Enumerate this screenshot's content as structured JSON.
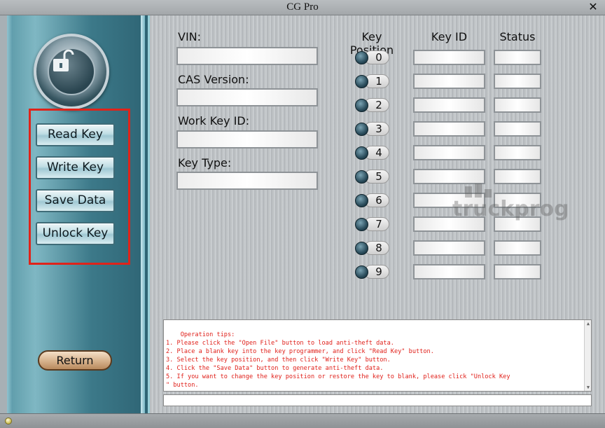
{
  "window": {
    "title": "CG Pro",
    "close_glyph": "✕"
  },
  "sidebar": {
    "buttons": [
      "Read Key",
      "Write Key",
      "Save Data",
      "Unlock Key"
    ],
    "return_label": "Return"
  },
  "fields": {
    "vin_label": "VIN:",
    "cas_label": "CAS Version:",
    "work_key_label": "Work Key ID:",
    "key_type_label": "Key Type:",
    "vin_value": "",
    "cas_value": "",
    "work_key_value": "",
    "key_type_value": ""
  },
  "keys": {
    "headers": {
      "position": "Key Position",
      "id": "Key ID",
      "status": "Status"
    },
    "positions": [
      "0",
      "1",
      "2",
      "3",
      "4",
      "5",
      "6",
      "7",
      "8",
      "9"
    ]
  },
  "tips": {
    "text": "Operation tips:\n1. Please click the \"Open File\" button to load anti-theft data.\n2. Place a blank key into the key programmer, and click \"Read Key\" button.\n3. Select the key position, and then click \"Write Key\" button.\n4. Click the \"Save Data\" button to generate anti-theft data.\n5. If you want to change the key position or restore the key to blank, please click \"Unlock Key\n\" button."
  },
  "icons": {
    "lock": "unlock-icon",
    "close": "close-icon",
    "led": "status-led-icon"
  },
  "colors": {
    "highlight_frame": "#e0231a",
    "tips_text": "#e0201a",
    "sidebar_accent": "#3c7989"
  }
}
